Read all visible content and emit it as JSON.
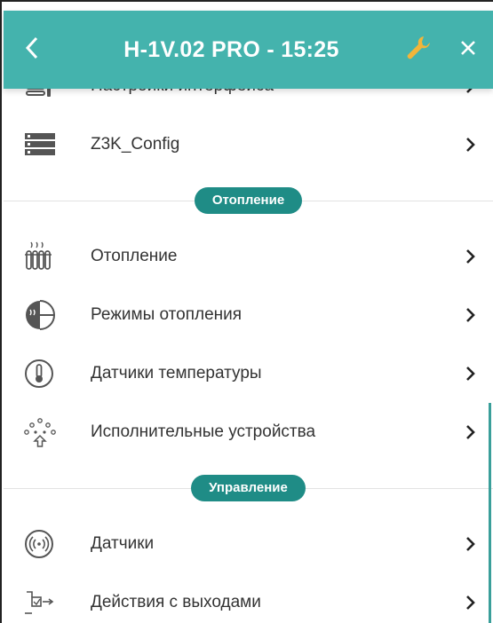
{
  "header": {
    "title": "H-1V.02 PRO - 15:25"
  },
  "items_top": [
    {
      "label": "Настройки интерфейса",
      "icon": "interface-settings-icon"
    },
    {
      "label": "Z3K_Config",
      "icon": "server-icon"
    }
  ],
  "section_heating": {
    "label": "Отопление"
  },
  "items_heating": [
    {
      "label": "Отопление",
      "icon": "radiator-icon"
    },
    {
      "label": "Режимы отопления",
      "icon": "heating-modes-icon"
    },
    {
      "label": "Датчики температуры",
      "icon": "thermometer-icon"
    },
    {
      "label": "Исполнительные устройства",
      "icon": "actuators-icon"
    }
  ],
  "section_control": {
    "label": "Управление"
  },
  "items_control": [
    {
      "label": "Датчики",
      "icon": "sensor-icon"
    },
    {
      "label": "Действия с выходами",
      "icon": "output-actions-icon"
    }
  ],
  "colors": {
    "header": "#44b3ad",
    "pill": "#1f8c86",
    "tool_icon": "#f2b53a"
  }
}
